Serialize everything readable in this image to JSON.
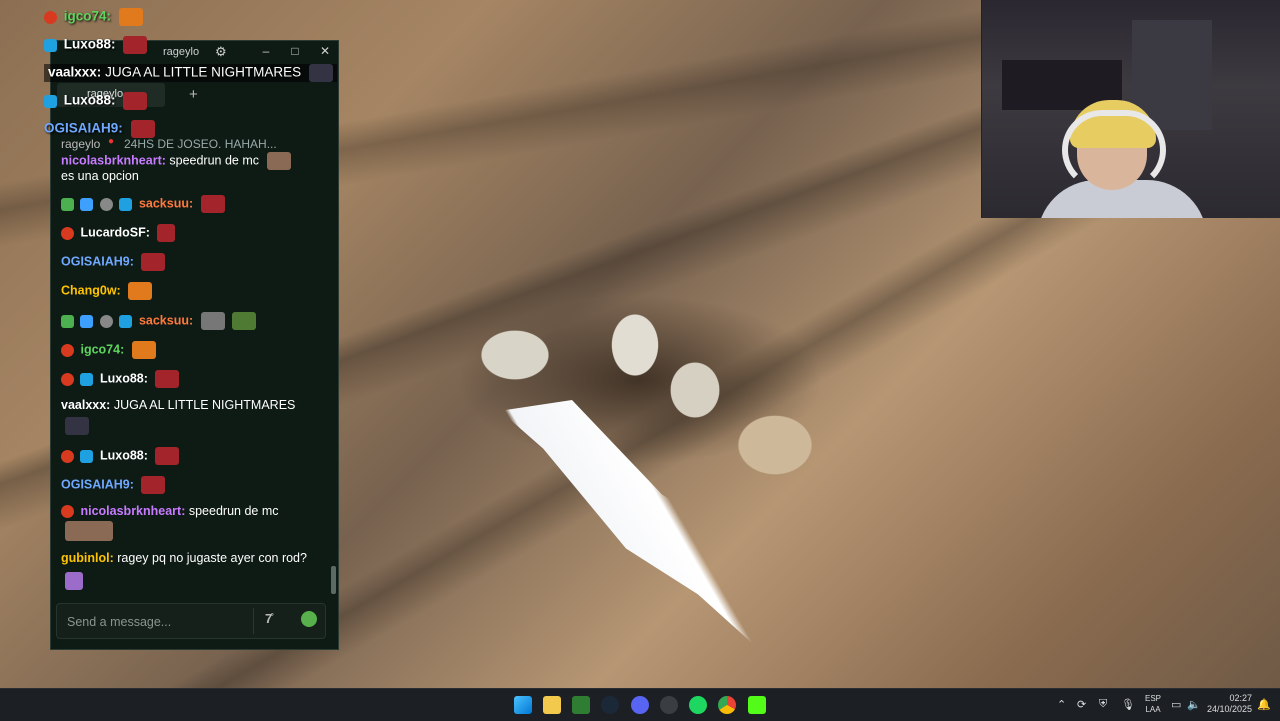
{
  "overlay_chat": [
    {
      "user": "igco74:",
      "color": "#5fd45f",
      "text": ""
    },
    {
      "user": "Luxo88:",
      "color": "#ffffff",
      "text": ""
    },
    {
      "user": "vaalxxx:",
      "color": "#ffffff",
      "text": "JUGA AL LITTLE NIGHTMARES"
    },
    {
      "user": "Luxo88:",
      "color": "#ffffff",
      "text": ""
    },
    {
      "user": "OGISAIAH9:",
      "color": "#6fa8ff",
      "text": ""
    }
  ],
  "chat_window": {
    "title": "rageylo",
    "tab_label": "rageylo",
    "add_tab": "+",
    "channel": {
      "name": "rageylo",
      "live_dot": "●",
      "stream_title": "24HS DE JOSEO. HAHAH..."
    },
    "messages": [
      {
        "user": "nicolasbrknheart:",
        "color": "#c77bff",
        "text": "speedrun de mc"
      },
      {
        "user": "",
        "color": "#ffffff",
        "text": "es una opcion"
      },
      {
        "user": "sacksuu:",
        "color": "#ff7a3d",
        "text": ""
      },
      {
        "user": "LucardoSF:",
        "color": "#ffffff",
        "text": ""
      },
      {
        "user": "OGISAIAH9:",
        "color": "#6fa8ff",
        "text": ""
      },
      {
        "user": "Chang0w:",
        "color": "#ffc400",
        "text": ""
      },
      {
        "user": "sacksuu:",
        "color": "#ff7a3d",
        "text": ""
      },
      {
        "user": "igco74:",
        "color": "#5fd45f",
        "text": ""
      },
      {
        "user": "Luxo88:",
        "color": "#ffffff",
        "text": ""
      },
      {
        "user": "vaalxxx:",
        "color": "#ffffff",
        "text": "JUGA AL LITTLE NIGHTMARES"
      },
      {
        "user": "Luxo88:",
        "color": "#ffffff",
        "text": ""
      },
      {
        "user": "OGISAIAH9:",
        "color": "#6fa8ff",
        "text": ""
      },
      {
        "user": "nicolasbrknheart:",
        "color": "#c77bff",
        "text": "speedrun de mc"
      },
      {
        "user": "gubinlol:",
        "color": "#ffc400",
        "text": "ragey pq no jugaste ayer con rod?"
      }
    ],
    "input_placeholder": "Send a message...",
    "translate_label": "7̊"
  },
  "taskbar": {
    "lang_top": "ESP",
    "lang_bottom": "LAA",
    "time": "02:27",
    "date": "24/10/2025"
  }
}
